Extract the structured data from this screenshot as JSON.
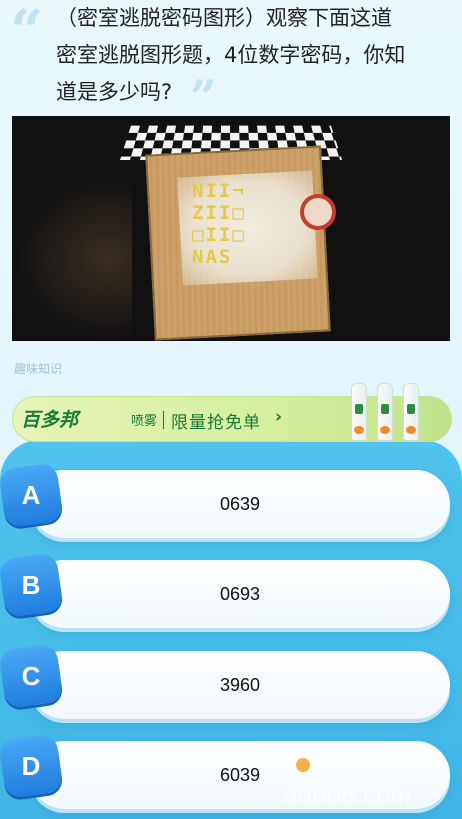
{
  "question": {
    "line1": "（密室逃脱密码图形）观察下面这道",
    "line2": "密室逃脱图形题，4位数字密码，你知",
    "line3": "道是多少吗?"
  },
  "photo_code": {
    "row1": "NII¬",
    "row2": "ZII□",
    "row3": "□II□",
    "row4": "NAS"
  },
  "fun_label": "趣味知识",
  "ad": {
    "brand": "百多邦",
    "brand_suffix": "喷雾",
    "text": "限量抢免单",
    "arrow": "›"
  },
  "options": [
    {
      "letter": "A",
      "value": "0639"
    },
    {
      "letter": "B",
      "value": "0693"
    },
    {
      "letter": "C",
      "value": "3960"
    },
    {
      "letter": "D",
      "value": "6039"
    }
  ],
  "watermark": "dd008.com",
  "colors": {
    "answer_bar": "#4fc3ec",
    "badge": "#1f7ddf",
    "ad_green": "#1a7a3a"
  }
}
